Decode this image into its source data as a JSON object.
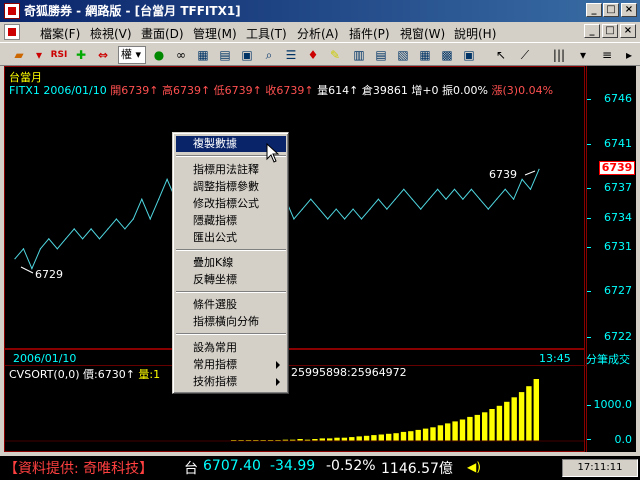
{
  "window": {
    "title": "奇狐勝券 - 網路版 - [台當月 TFFITX1]",
    "btn_min": "_",
    "btn_max": "□",
    "btn_close": "×"
  },
  "menubar": {
    "items": [
      "檔案(F)",
      "檢視(V)",
      "畫面(D)",
      "管理(M)",
      "工具(T)",
      "分析(A)",
      "插件(P)",
      "視窗(W)",
      "說明(H)"
    ]
  },
  "toolbar": {
    "period_select": "權",
    "icons": [
      "open-icon",
      "rsi-icon",
      "crosshair-icon",
      "arrows-icon",
      "indicator-icon",
      "glasses-icon",
      "table-icon",
      "chart-icon",
      "alarm-icon",
      "pen-icon",
      "grid-icon",
      "window-icon",
      "cursor-icon",
      "line-icon",
      "bars-icon"
    ]
  },
  "chart": {
    "symbol": "台當月",
    "code": "FITX1",
    "date": "2006/01/10",
    "open_label": "開6739",
    "high_label": "高6739",
    "low_label": "低6739",
    "close_label": "收6739",
    "volume_label": "量614",
    "oi_label": "倉39861",
    "change_label": "增+0",
    "amp_label": "振0.00%",
    "rise_label": "漲(3)0.04%",
    "y_ticks": [
      "6746",
      "6741",
      "6737",
      "6734",
      "6731",
      "6727",
      "6722"
    ],
    "current_price": "6739",
    "annotation_high": "6739",
    "annotation_low": "6729",
    "lower_date": "2006/01/10",
    "lower_time": "13:45",
    "lower_axis_label": "分筆成交",
    "lower_info_prefix": "CVSORT(0,0)",
    "lower_price": "價:6730",
    "lower_vol": "量:1",
    "lower_extra": "25995898:25964972",
    "lower_ticks": [
      "1000.0",
      "0.0"
    ]
  },
  "chart_data": {
    "type": "line",
    "title": "台當月",
    "xlabel": "",
    "ylabel": "",
    "ylim": [
      6722,
      6746
    ],
    "series": [
      {
        "values": [
          6730,
          6731,
          6729,
          6731,
          6732,
          6731,
          6732,
          6733,
          6732,
          6733,
          6732,
          6733,
          6734,
          6733,
          6734,
          6736,
          6734,
          6736,
          6738,
          6736,
          6737,
          6735,
          6733,
          6735,
          6734,
          6733,
          6734,
          6736,
          6735,
          6736,
          6734,
          6735,
          6736,
          6734,
          6735,
          6736,
          6735,
          6734,
          6735,
          6734,
          6735,
          6734,
          6735,
          6736,
          6735,
          6736,
          6737,
          6736,
          6735,
          6736,
          6737,
          6736,
          6737,
          6736,
          6737,
          6736,
          6735,
          6736,
          6737,
          6736,
          6738,
          6737,
          6739
        ]
      }
    ],
    "volume": [
      0,
      0,
      1,
      0,
      1,
      1,
      1,
      2,
      2,
      3,
      2,
      3,
      4,
      4,
      5,
      5,
      6,
      7,
      8,
      9,
      10,
      11,
      12,
      14,
      15,
      17,
      19,
      21,
      24,
      27,
      30,
      33,
      37,
      40,
      44,
      49,
      54,
      60,
      67,
      75,
      84,
      95
    ]
  },
  "context_menu": {
    "items": [
      {
        "label": "複製數據",
        "highlight": true
      },
      {
        "sep": true
      },
      {
        "label": "指標用法註釋"
      },
      {
        "label": "調整指標參數"
      },
      {
        "label": "修改指標公式"
      },
      {
        "label": "隱藏指標"
      },
      {
        "label": "匯出公式"
      },
      {
        "sep": true
      },
      {
        "label": "疊加K線"
      },
      {
        "label": "反轉坐標"
      },
      {
        "sep": true
      },
      {
        "label": "條件選股"
      },
      {
        "label": "指標橫向分佈"
      },
      {
        "sep": true
      },
      {
        "label": "設為常用"
      },
      {
        "label": "常用指標",
        "submenu": true
      },
      {
        "label": "技術指標",
        "submenu": true
      }
    ]
  },
  "statusbar": {
    "provider": "【資料提供: 奇唯科技】",
    "index_name": "台",
    "index_value": "6707.40",
    "index_change": "-34.99",
    "index_pct": "-0.52%",
    "index_amount": "1146.57億",
    "clock": "17:11:11"
  },
  "colors": {
    "line": "#4fd6e0",
    "volume": "#ffff00",
    "axis": "#00ffff",
    "red": "#ff5050"
  }
}
